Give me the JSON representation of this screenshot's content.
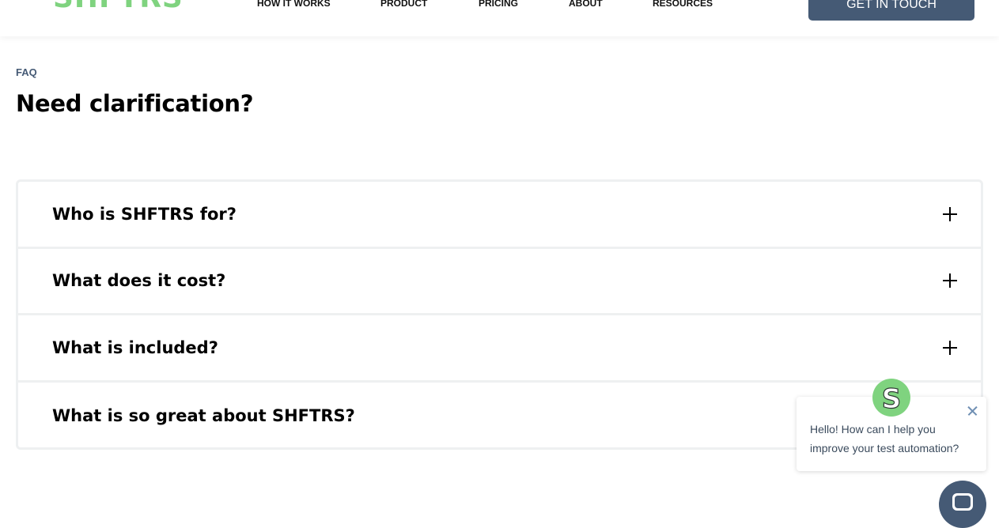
{
  "header": {
    "logo_text": "SHFTRS",
    "nav": [
      {
        "label": "HOW IT WORKS"
      },
      {
        "label": "PRODUCT"
      },
      {
        "label": "PRICING"
      },
      {
        "label": "ABOUT"
      },
      {
        "label": "RESOURCES"
      }
    ],
    "cta_label": "GET IN TOUCH"
  },
  "faq_section": {
    "eyebrow": "FAQ",
    "title": "Need clarification?",
    "items": [
      {
        "question": "Who is SHFTRS for?",
        "icon": "plus-icon"
      },
      {
        "question": "What does it cost?",
        "icon": "plus-icon"
      },
      {
        "question": "What is included?",
        "icon": "plus-icon"
      },
      {
        "question": "What is so great about SHFTRS?",
        "icon": "plus-icon"
      }
    ]
  },
  "chat": {
    "message": "Hello! How can I help you improve your test automation?",
    "avatar_letter": "S",
    "close_icon": "close-icon",
    "launcher_icon": "chat-icon"
  },
  "colors": {
    "brand_green": "#7fd37f",
    "brand_navy": "#455a75",
    "border": "#eef0f1"
  }
}
